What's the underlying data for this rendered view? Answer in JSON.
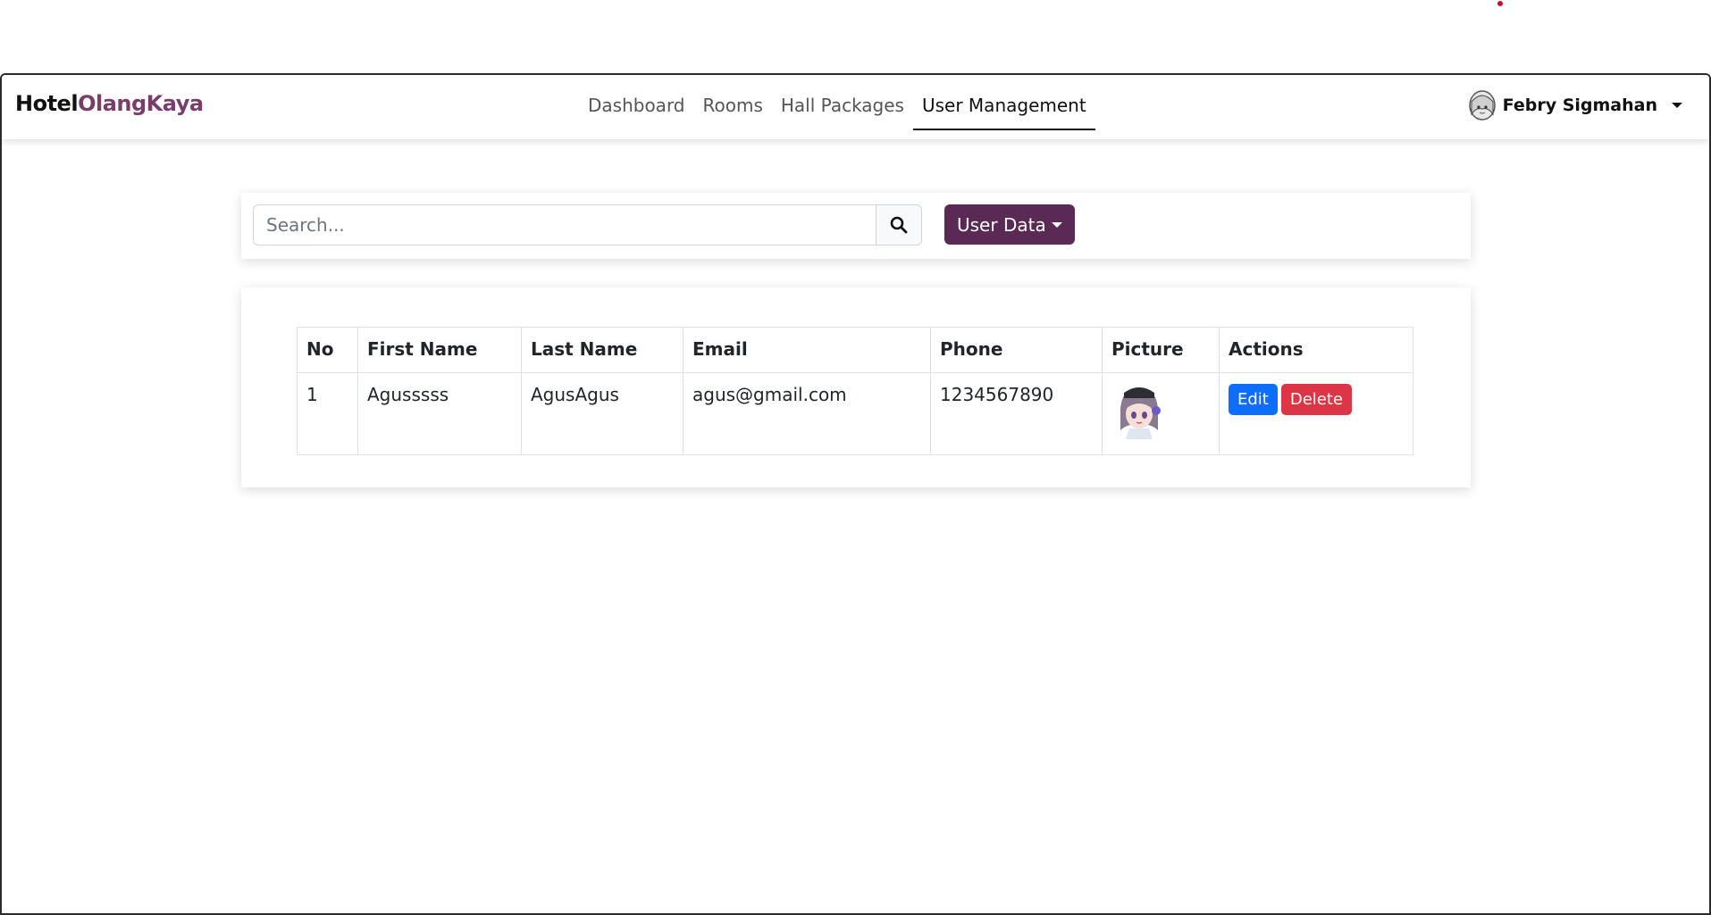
{
  "brand": {
    "part1": "Hotel",
    "part2": "OlangKaya"
  },
  "nav": {
    "items": [
      {
        "label": "Dashboard"
      },
      {
        "label": "Rooms"
      },
      {
        "label": "Hall Packages"
      },
      {
        "label": "User Management"
      }
    ],
    "active": "User Management"
  },
  "user": {
    "name": "Febry Sigmahan"
  },
  "search": {
    "placeholder": "Search...",
    "value": ""
  },
  "filter": {
    "label": "User Data"
  },
  "table": {
    "headers": [
      "No",
      "First Name",
      "Last Name",
      "Email",
      "Phone",
      "Picture",
      "Actions"
    ],
    "rows": [
      {
        "no": "1",
        "first_name": "Agusssss",
        "last_name": "AgusAgus",
        "email": "agus@gmail.com",
        "phone": "1234567890",
        "edit_label": "Edit",
        "delete_label": "Delete"
      }
    ]
  },
  "colors": {
    "brand_accent": "#7a3d6b",
    "primary_button": "#5a2a55",
    "edit": "#0d6efd",
    "delete": "#dc3545"
  }
}
